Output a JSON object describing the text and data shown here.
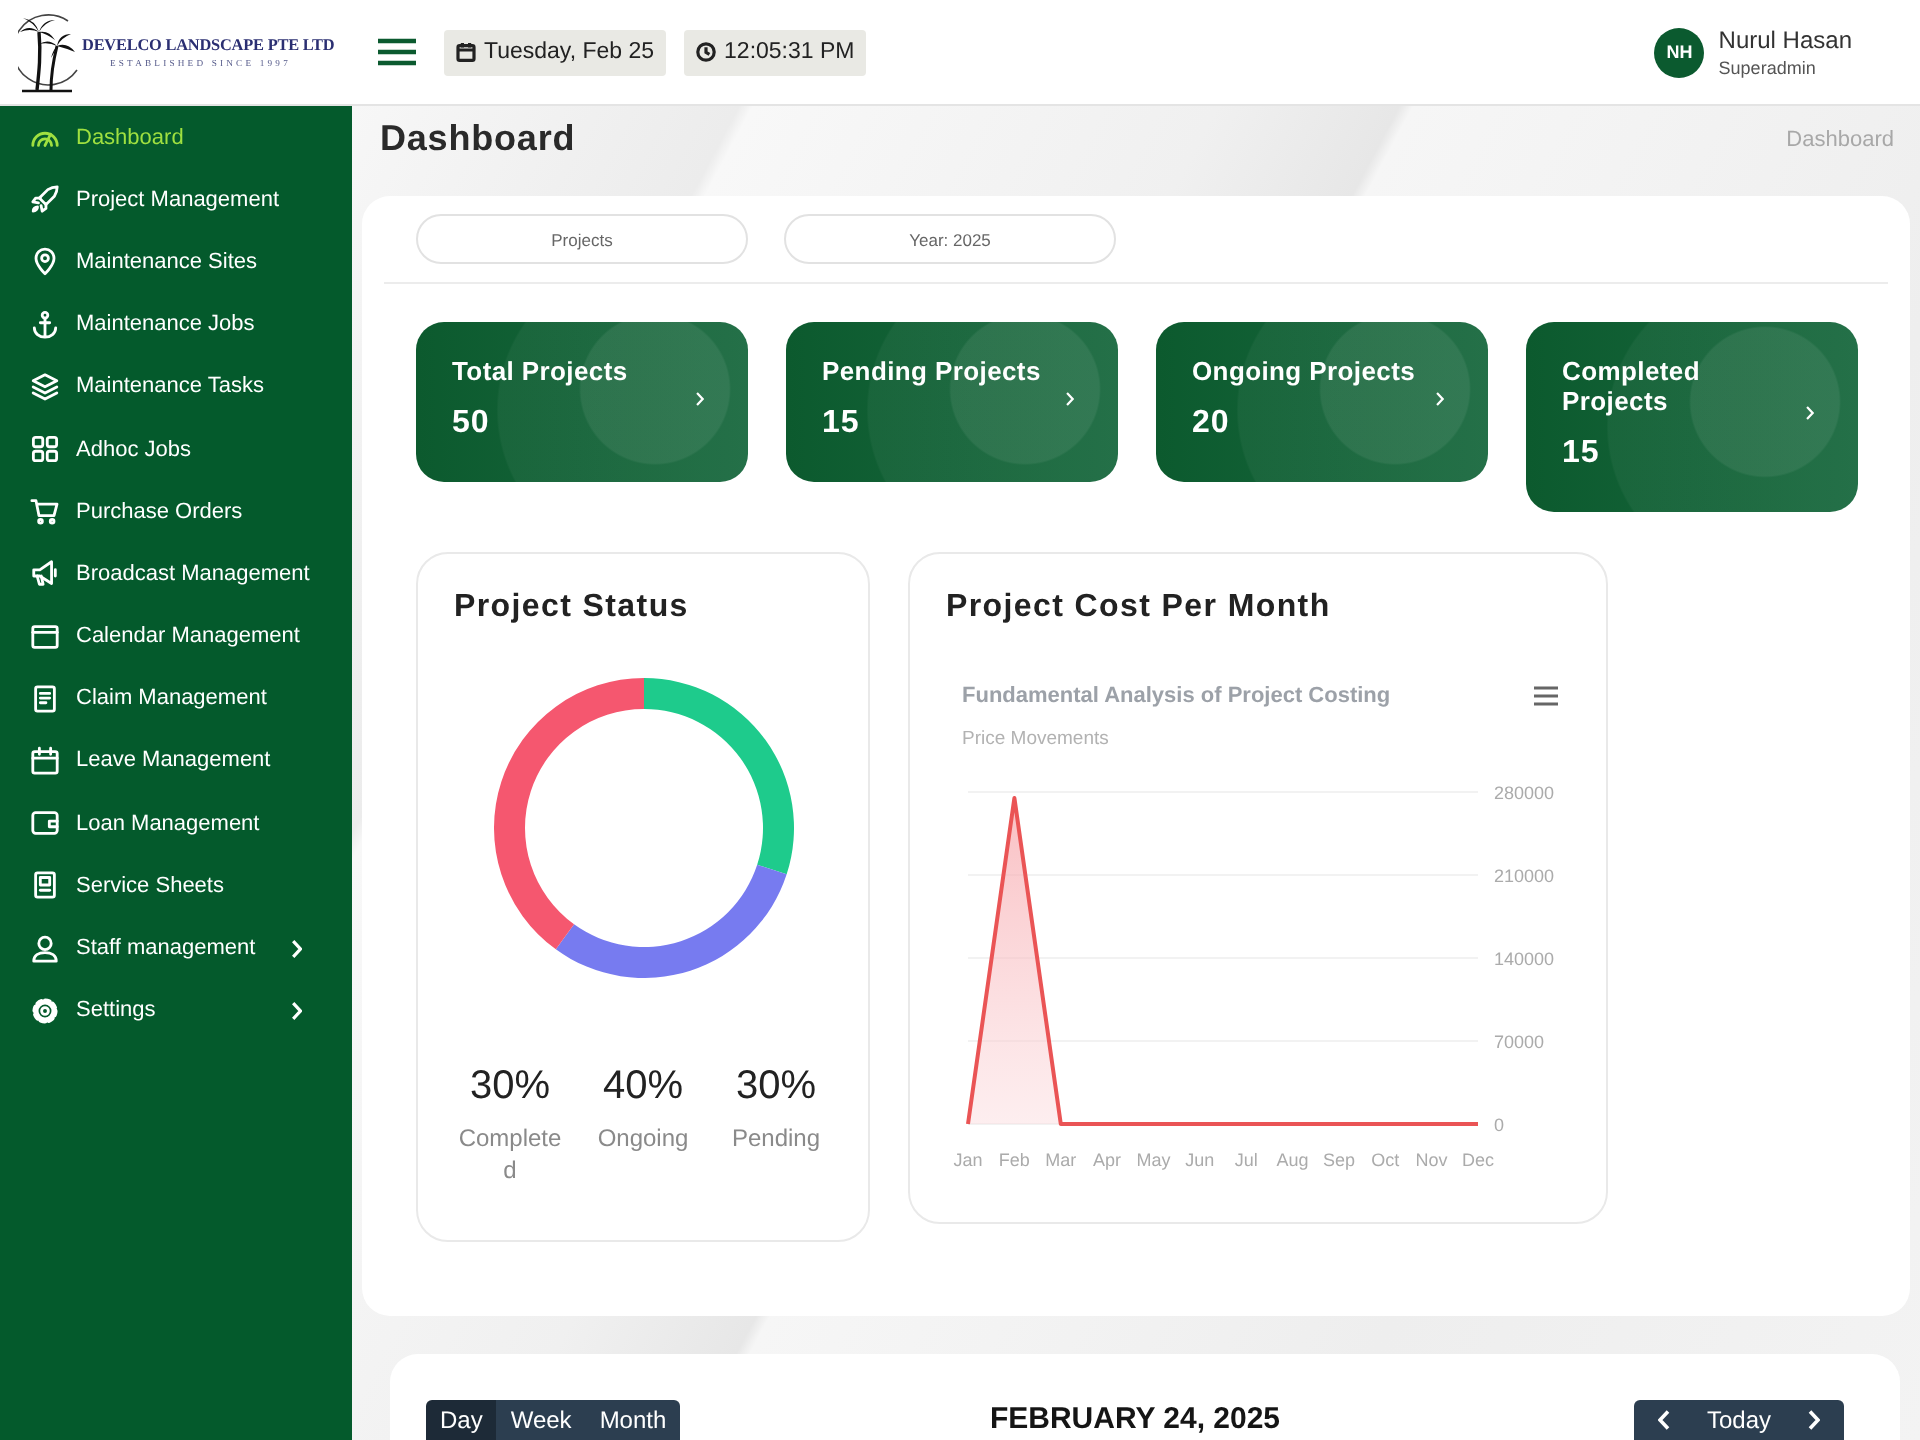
{
  "header": {
    "logo": {
      "name": "DEVELCO LANDSCAPE PTE LTD",
      "tagline": "ESTABLISHED SINCE 1997"
    },
    "date": "Tuesday, Feb 25",
    "time": "12:05:31 PM",
    "user": {
      "initials": "NH",
      "name": "Nurul Hasan",
      "role": "Superadmin"
    }
  },
  "sidebar": {
    "items": [
      {
        "label": "Dashboard",
        "selected": true,
        "submenu": false
      },
      {
        "label": "Project Management",
        "selected": false,
        "submenu": false
      },
      {
        "label": "Maintenance Sites",
        "selected": false,
        "submenu": false
      },
      {
        "label": "Maintenance Jobs",
        "selected": false,
        "submenu": false
      },
      {
        "label": "Maintenance Tasks",
        "selected": false,
        "submenu": false
      },
      {
        "label": "Adhoc Jobs",
        "selected": false,
        "submenu": false
      },
      {
        "label": "Purchase Orders",
        "selected": false,
        "submenu": false
      },
      {
        "label": "Broadcast Management",
        "selected": false,
        "submenu": false
      },
      {
        "label": "Calendar Management",
        "selected": false,
        "submenu": false
      },
      {
        "label": "Claim Management",
        "selected": false,
        "submenu": false
      },
      {
        "label": "Leave Management",
        "selected": false,
        "submenu": false
      },
      {
        "label": "Loan Management",
        "selected": false,
        "submenu": false
      },
      {
        "label": "Service Sheets",
        "selected": false,
        "submenu": false
      },
      {
        "label": "Staff management",
        "selected": false,
        "submenu": true
      },
      {
        "label": "Settings",
        "selected": false,
        "submenu": true
      }
    ]
  },
  "page": {
    "title": "Dashboard",
    "breadcrumb": "Dashboard"
  },
  "filters": [
    {
      "label": "Projects"
    },
    {
      "label": "Year: 2025"
    }
  ],
  "stats": [
    {
      "title": "Total Projects",
      "value": "50"
    },
    {
      "title": "Pending Projects",
      "value": "15"
    },
    {
      "title": "Ongoing Projects",
      "value": "20"
    },
    {
      "title": "Completed Projects",
      "value": "15"
    }
  ],
  "project_status": {
    "title": "Project Status",
    "chart_data": {
      "type": "donut",
      "values": [
        30,
        30,
        40
      ]
    },
    "legend": [
      {
        "value": "30%",
        "label": "Completed"
      },
      {
        "value": "40%",
        "label": "Ongoing"
      },
      {
        "value": "30%",
        "label": "Pending"
      }
    ]
  },
  "project_cost": {
    "title": "Project Cost Per Month",
    "chart_subtitle": "Price Movements",
    "chart_data": {
      "type": "area",
      "title": "Fundamental Analysis of Project Costing",
      "categories": [
        "Jan",
        "Feb",
        "Mar",
        "Apr",
        "May",
        "Jun",
        "Jul",
        "Aug",
        "Sep",
        "Oct",
        "Nov",
        "Dec"
      ],
      "values": [
        0,
        275000,
        0,
        0,
        0,
        0,
        0,
        0,
        0,
        0,
        0,
        0
      ],
      "ylim": [
        0,
        280000
      ],
      "yticks": [
        0,
        70000,
        140000,
        210000,
        280000
      ],
      "grid": true
    }
  },
  "calendar": {
    "views": [
      {
        "label": "Day",
        "selected": true
      },
      {
        "label": "Week",
        "selected": false
      },
      {
        "label": "Month",
        "selected": false
      }
    ],
    "title": "FEBRUARY 24, 2025",
    "today": "Today"
  }
}
